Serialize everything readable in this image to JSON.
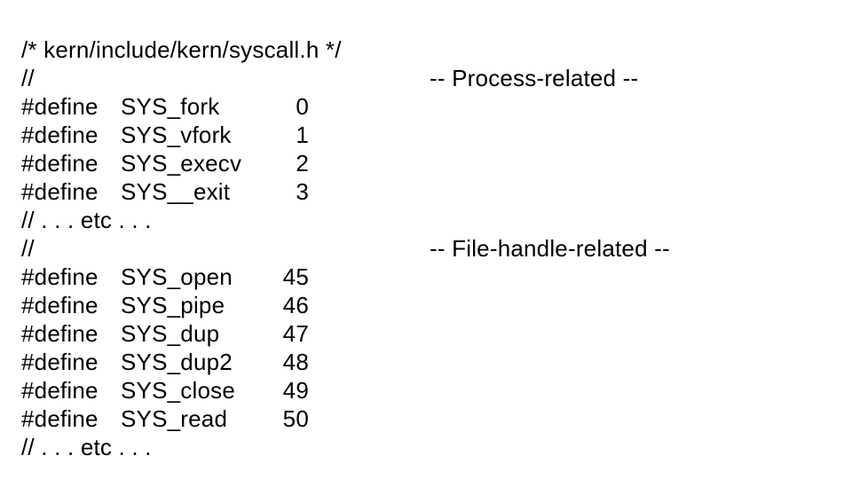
{
  "file_comment": "/* kern/include/kern/syscall.h */",
  "section1_prefix": "//",
  "section1_label": "-- Process-related --",
  "defines1": [
    {
      "kw": "#define",
      "name": "SYS_fork",
      "num": "0"
    },
    {
      "kw": "#define",
      "name": "SYS_vfork",
      "num": "1"
    },
    {
      "kw": "#define",
      "name": "SYS_execv",
      "num": "2"
    },
    {
      "kw": "#define",
      "name": "SYS__exit",
      "num": "3"
    }
  ],
  "etc1": "// . . . etc . . .",
  "section2_prefix": "//",
  "section2_label": "-- File-handle-related --",
  "defines2": [
    {
      "kw": "#define",
      "name": "SYS_open",
      "num": "45"
    },
    {
      "kw": "#define",
      "name": "SYS_pipe",
      "num": "46"
    },
    {
      "kw": "#define",
      "name": "SYS_dup",
      "num": "47"
    },
    {
      "kw": "#define",
      "name": "SYS_dup2",
      "num": "48"
    },
    {
      "kw": "#define",
      "name": "SYS_close",
      "num": "49"
    },
    {
      "kw": "#define",
      "name": "SYS_read",
      "num": "50"
    }
  ],
  "etc2": "// . . . etc . . ."
}
